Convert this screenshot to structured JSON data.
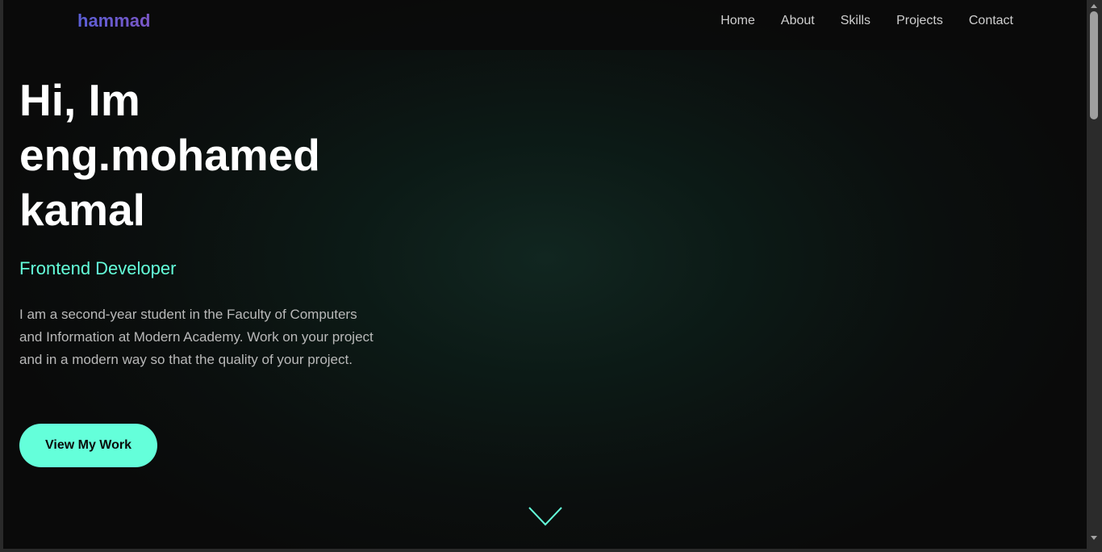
{
  "header": {
    "logo": "hammad",
    "nav": [
      {
        "label": "Home"
      },
      {
        "label": "About"
      },
      {
        "label": "Skills"
      },
      {
        "label": "Projects"
      },
      {
        "label": "Contact"
      }
    ]
  },
  "hero": {
    "title_line1": "Hi, Im",
    "title_line2": "eng.mohamed",
    "title_line3": "kamal",
    "subtitle": "Frontend Developer",
    "description": "I am a second-year student in the Faculty of Computers and Information at Modern Academy. Work on your project and in a modern way so that the quality of your project.",
    "cta_label": "View My Work"
  },
  "icons": {
    "scroll_down": "chevron-down-icon"
  },
  "colors": {
    "accent": "#64ffda",
    "logo": "#6f63d8",
    "background": "#0a0a0a",
    "text": "#ffffff",
    "muted_text": "#b9b9b9"
  }
}
